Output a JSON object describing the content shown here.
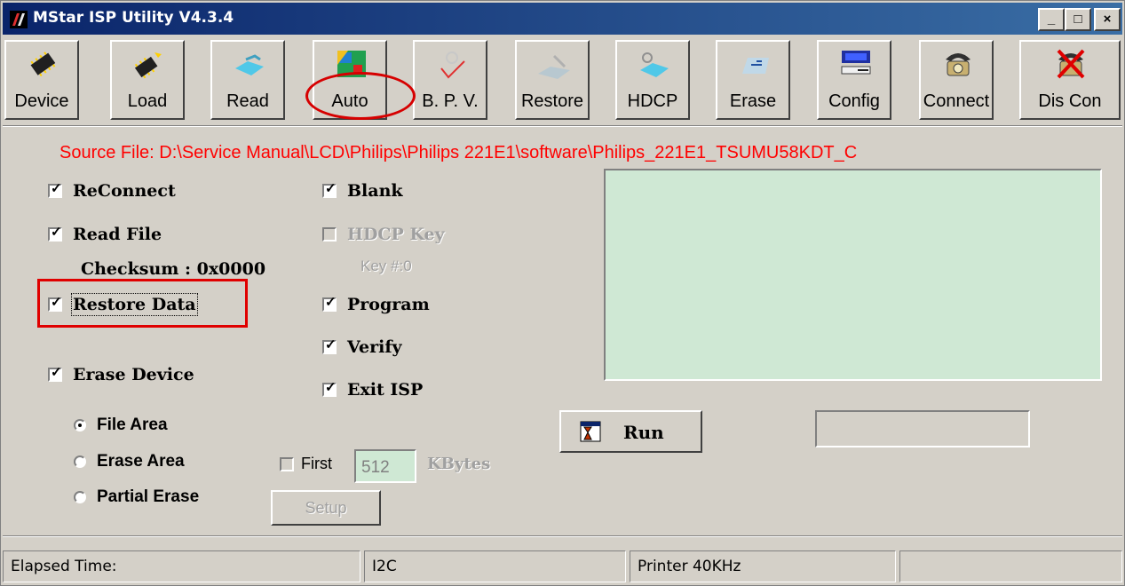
{
  "window": {
    "title": "MStar ISP Utility V4.3.4"
  },
  "title_buttons": {
    "minimize": "_",
    "maximize": "□",
    "close": "×"
  },
  "toolbar": [
    {
      "label": "Device",
      "icon": "chip-icon",
      "enabled": true
    },
    {
      "label": "Load",
      "icon": "chip-load-icon",
      "enabled": true
    },
    {
      "label": "Read",
      "icon": "read-arrow-icon",
      "enabled": true
    },
    {
      "label": "Auto",
      "icon": "auto-icon",
      "enabled": true
    },
    {
      "label": "B. P. V.",
      "icon": "checkmark-icon",
      "enabled": false
    },
    {
      "label": "Restore",
      "icon": "restore-icon",
      "enabled": false
    },
    {
      "label": "HDCP",
      "icon": "hdcp-key-icon",
      "enabled": true
    },
    {
      "label": "Erase",
      "icon": "eraser-icon",
      "enabled": true
    },
    {
      "label": "Config",
      "icon": "computer-icon",
      "enabled": true
    },
    {
      "label": "Connect",
      "icon": "telephone-icon",
      "enabled": true
    },
    {
      "label": "Dis Con",
      "icon": "disconnect-icon",
      "enabled": true
    }
  ],
  "source_file": "Source File: D:\\Service Manual\\LCD\\Philips\\Philips 221E1\\software\\Philips_221E1_TSUMU58KDT_C",
  "options_left": {
    "reconnect": {
      "label": "ReConnect",
      "checked": true
    },
    "read_file": {
      "label": "Read File",
      "checked": true
    },
    "checksum": "Checksum : 0x0000",
    "restore_data": {
      "label": "Restore Data",
      "checked": true
    },
    "erase_device": {
      "label": "Erase Device",
      "checked": true
    }
  },
  "options_right": {
    "blank": {
      "label": "Blank",
      "checked": true
    },
    "hdcp_key": {
      "label": "HDCP Key",
      "checked": false,
      "enabled": false
    },
    "key_number": "Key #:0",
    "program": {
      "label": "Program",
      "checked": true
    },
    "verify": {
      "label": "Verify",
      "checked": true
    },
    "exit_isp": {
      "label": "Exit ISP",
      "checked": true
    }
  },
  "erase_mode": {
    "options": [
      "File Area",
      "Erase Area",
      "Partial Erase"
    ],
    "selected": "File Area"
  },
  "first_kbytes": {
    "label": "First",
    "value": "512",
    "unit": "KBytes",
    "enabled": false
  },
  "setup_button": "Setup",
  "run_button": "Run",
  "status_bar": {
    "elapsed": "Elapsed Time:",
    "interface": "I2C",
    "speed": "Printer  40KHz",
    "extra": ""
  },
  "colors": {
    "title_bar": "#0a246a",
    "source_file_text": "#ff0000",
    "log_background": "#cfe8d4",
    "annotation": "#e00000"
  }
}
